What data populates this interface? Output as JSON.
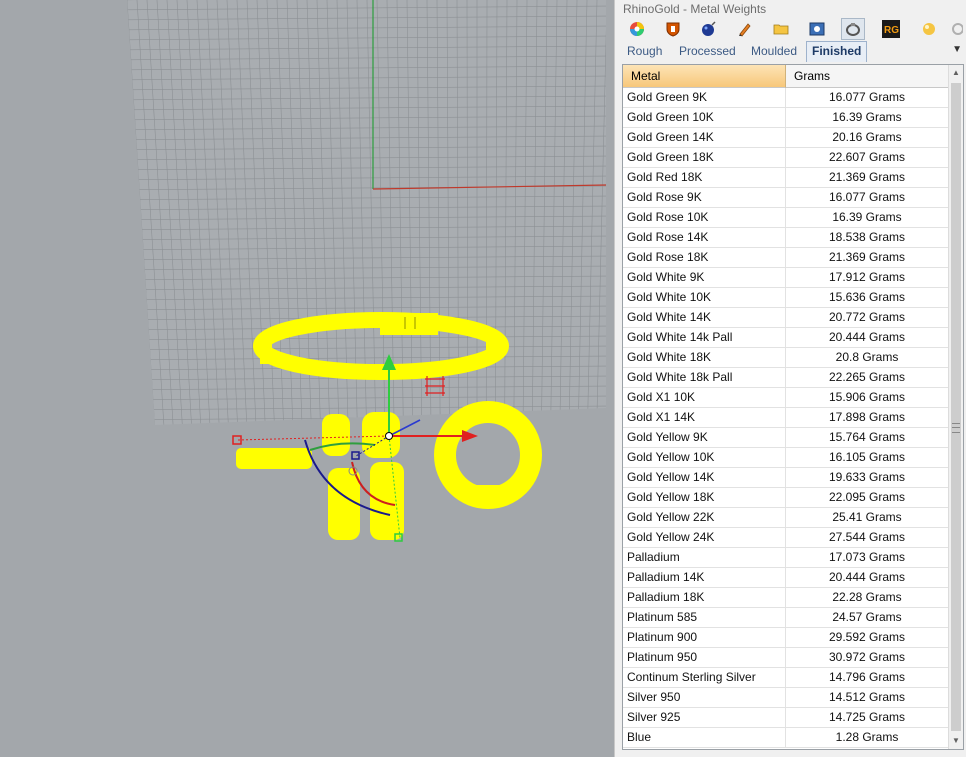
{
  "panel": {
    "title": "RhinoGold - Metal Weights",
    "toolbar_icons": [
      "color-wheel-icon",
      "shield-icon",
      "bomb-icon",
      "pen-icon",
      "folder-icon",
      "image-icon",
      "ring-icon",
      "rg-logo-icon",
      "gem-icon",
      "gear-icon"
    ],
    "tabs": [
      {
        "label": "Rough",
        "active": false
      },
      {
        "label": "Processed",
        "active": false
      },
      {
        "label": "Moulded",
        "active": false
      },
      {
        "label": "Finished",
        "active": true
      }
    ],
    "columns": {
      "metal": "Metal",
      "grams": "Grams"
    },
    "rows": [
      {
        "metal": "Gold Green 9K",
        "grams": "16.077 Grams"
      },
      {
        "metal": "Gold Green 10K",
        "grams": "16.39 Grams"
      },
      {
        "metal": "Gold Green 14K",
        "grams": "20.16 Grams"
      },
      {
        "metal": "Gold Green 18K",
        "grams": "22.607 Grams"
      },
      {
        "metal": "Gold Red 18K",
        "grams": "21.369 Grams"
      },
      {
        "metal": "Gold Rose 9K",
        "grams": "16.077 Grams"
      },
      {
        "metal": "Gold Rose 10K",
        "grams": "16.39 Grams"
      },
      {
        "metal": "Gold Rose 14K",
        "grams": "18.538 Grams"
      },
      {
        "metal": "Gold Rose 18K",
        "grams": "21.369 Grams"
      },
      {
        "metal": "Gold White 9K",
        "grams": "17.912 Grams"
      },
      {
        "metal": "Gold White 10K",
        "grams": "15.636 Grams"
      },
      {
        "metal": "Gold White 14K",
        "grams": "20.772 Grams"
      },
      {
        "metal": "Gold White 14k Pall",
        "grams": "20.444 Grams"
      },
      {
        "metal": "Gold White 18K",
        "grams": "20.8 Grams"
      },
      {
        "metal": "Gold White 18k Pall",
        "grams": "22.265 Grams"
      },
      {
        "metal": "Gold X1 10K",
        "grams": "15.906 Grams"
      },
      {
        "metal": "Gold X1 14K",
        "grams": "17.898 Grams"
      },
      {
        "metal": "Gold Yellow 9K",
        "grams": "15.764 Grams"
      },
      {
        "metal": "Gold Yellow 10K",
        "grams": "16.105 Grams"
      },
      {
        "metal": "Gold Yellow 14K",
        "grams": "19.633 Grams"
      },
      {
        "metal": "Gold Yellow 18K",
        "grams": "22.095 Grams"
      },
      {
        "metal": "Gold Yellow 22K",
        "grams": "25.41 Grams"
      },
      {
        "metal": "Gold Yellow 24K",
        "grams": "27.544 Grams"
      },
      {
        "metal": "Palladium",
        "grams": "17.073 Grams"
      },
      {
        "metal": "Palladium 14K",
        "grams": "20.444 Grams"
      },
      {
        "metal": "Palladium 18K",
        "grams": "22.28 Grams"
      },
      {
        "metal": "Platinum 585",
        "grams": "24.57 Grams"
      },
      {
        "metal": "Platinum 900",
        "grams": "29.592 Grams"
      },
      {
        "metal": "Platinum 950",
        "grams": "30.972 Grams"
      },
      {
        "metal": "Continum Sterling Silver",
        "grams": "14.796 Grams"
      },
      {
        "metal": "Silver 950",
        "grams": "14.512 Grams"
      },
      {
        "metal": "Silver 925",
        "grams": "14.725 Grams"
      },
      {
        "metal": "Blue",
        "grams": "1.28 Grams"
      }
    ]
  },
  "viewport": {
    "background_color": "#a3a7ab",
    "object_color": "#ffff00",
    "x_axis_color": "#c0392b",
    "y_axis_color": "#2e9e3e"
  }
}
